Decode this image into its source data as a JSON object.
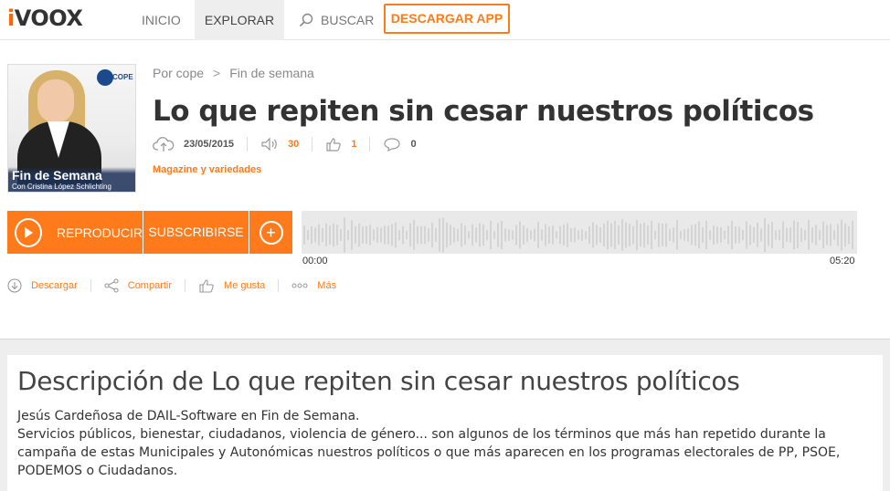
{
  "header": {
    "logo_prefix": "i",
    "logo_rest": "VOOX",
    "nav": {
      "inicio": "INICIO",
      "explorar": "EXPLORAR",
      "buscar": "BUSCAR"
    },
    "app_button": "DESCARGAR APP"
  },
  "cover": {
    "brand": "COPE",
    "show_title": "Fin de Semana",
    "show_subtitle": "Con Cristina López Schlichting"
  },
  "breadcrumb": {
    "by": "Por cope",
    "separator": ">",
    "program": "Fin de semana"
  },
  "episode": {
    "title": "Lo que repiten sin cesar nuestros políticos",
    "date": "23/05/2015",
    "plays": "30",
    "likes": "1",
    "comments": "0",
    "category": "Magazine y variedades"
  },
  "player": {
    "play_label": "REPRODUCIR",
    "subscribe_label": "SUBSCRIBIRSE",
    "add_symbol": "+",
    "time_start": "00:00",
    "time_end": "05:20"
  },
  "actions": {
    "download": "Descargar",
    "share": "Compartir",
    "like": "Me gusta",
    "more": "Más"
  },
  "description": {
    "title": "Descripción de Lo que repiten sin cesar nuestros políticos",
    "line1": "Jesús Cardeñosa de DAIL-Software en Fin de Semana.",
    "line2": "Servicios públicos, bienestar, ciudadanos, violencia de género... son algunos de los términos que más han repetido durante la campaña de estas Municipales y Autonómicas nuestros políticos o que más aparecen en los programas electorales de PP, PSOE, PODEMOS o Ciudadanos."
  },
  "colors": {
    "accent": "#ff7a1a",
    "waveform_bg": "#e9e9e9",
    "waveform_bar": "#d4d4d4"
  }
}
